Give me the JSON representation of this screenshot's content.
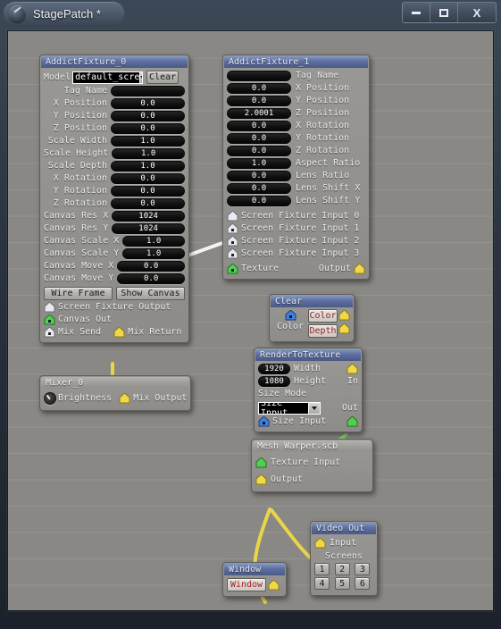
{
  "window": {
    "title": "StagePatch *",
    "app_icon": "disc-icon",
    "buttons": [
      {
        "name": "minimize",
        "glyph": "minimize-icon",
        "label": ""
      },
      {
        "name": "maximize",
        "glyph": "maximize-icon",
        "label": ""
      },
      {
        "name": "close",
        "glyph": "close-icon",
        "label": "X"
      }
    ]
  },
  "nodes": {
    "addict_fixture_0": {
      "title": "AddictFixture_0",
      "model_label": "Model",
      "model_value": "default_scre",
      "clear_button": "Clear",
      "fields": [
        {
          "label": "Tag Name",
          "value": ""
        },
        {
          "label": "X Position",
          "value": "0.0"
        },
        {
          "label": "Y Position",
          "value": "0.0"
        },
        {
          "label": "Z Position",
          "value": "0.0"
        },
        {
          "label": "Scale Width",
          "value": "1.0"
        },
        {
          "label": "Scale Height",
          "value": "1.0"
        },
        {
          "label": "Scale Depth",
          "value": "1.0"
        },
        {
          "label": "X Rotation",
          "value": "0.0"
        },
        {
          "label": "Y Rotation",
          "value": "0.0"
        },
        {
          "label": "Z Rotation",
          "value": "0.0"
        },
        {
          "label": "Canvas Res X",
          "value": "1024"
        },
        {
          "label": "Canvas Res Y",
          "value": "1024"
        },
        {
          "label": "Canvas Scale X",
          "value": "1.0"
        },
        {
          "label": "Canvas Scale Y",
          "value": "1.0"
        },
        {
          "label": "Canvas Move X",
          "value": "0.0"
        },
        {
          "label": "Canvas Move Y",
          "value": "0.0"
        }
      ],
      "wire_frame_button": "Wire Frame",
      "show_canvas_button": "Show Canvas",
      "ports": [
        {
          "label": "Screen Fixture Output",
          "color": "#e9e9ef",
          "kind": "output"
        },
        {
          "label": "Canvas Out",
          "color": "#4fd04f",
          "kind": "output"
        },
        {
          "label": "Mix Send",
          "color": "#e9e9ef",
          "kind": "output"
        },
        {
          "label": "Mix Return",
          "color": "#efd84a",
          "kind": "input"
        }
      ]
    },
    "addict_fixture_1": {
      "title": "AddictFixture_1",
      "fields": [
        {
          "label": "Tag Name",
          "value": ""
        },
        {
          "label": "X Position",
          "value": "0.0"
        },
        {
          "label": "Y Position",
          "value": "0.0"
        },
        {
          "label": "Z Position",
          "value": "2.0001"
        },
        {
          "label": "X Rotation",
          "value": "0.0"
        },
        {
          "label": "Y Rotation",
          "value": "0.0"
        },
        {
          "label": "Z Rotation",
          "value": "0.0"
        },
        {
          "label": "Aspect Ratio",
          "value": "1.0"
        },
        {
          "label": "Lens Ratio",
          "value": "0.0"
        },
        {
          "label": "Lens Shift X",
          "value": "0.0"
        },
        {
          "label": "Lens Shift Y",
          "value": "0.0"
        }
      ],
      "inputs": [
        {
          "label": "Screen Fixture Input 0",
          "color": "#e9e9ef"
        },
        {
          "label": "Screen Fixture Input 1",
          "color": "#e9e9ef"
        },
        {
          "label": "Screen Fixture Input 2",
          "color": "#e9e9ef"
        },
        {
          "label": "Screen Fixture Input 3",
          "color": "#e9e9ef"
        }
      ],
      "texture_label": "Texture",
      "texture_color": "#4fd04f",
      "output_label": "Output",
      "output_color": "#efd84a"
    },
    "mixer_0": {
      "title": "Mixer_0",
      "brightness_label": "Brightness",
      "mix_output_label": "Mix Output",
      "mix_output_color": "#efd84a"
    },
    "clear": {
      "title": "Clear",
      "color_port_label": "Color",
      "color_port_color": "#3f7fe0",
      "color_button": "Color",
      "depth_button": "Depth",
      "in_port_color": "#efd84a",
      "out_port_color": "#efd84a"
    },
    "render_to_texture": {
      "title": "RenderToTexture",
      "width_value": "1920",
      "width_label": "Width",
      "height_value": "1080",
      "height_label": "Height",
      "size_mode_label": "Size Mode",
      "size_mode_value": "Size Input",
      "size_input_label": "Size Input",
      "size_input_color": "#3f7fe0",
      "in_label": "In",
      "in_color": "#efd84a",
      "out_label": "Out",
      "out_color": "#4fd04f"
    },
    "mesh_warper": {
      "title": "Mesh Warper.scb",
      "texture_input_label": "Texture Input",
      "texture_input_color": "#4fd04f",
      "output_label": "Output",
      "output_color": "#efd84a"
    },
    "window_node": {
      "title": "Window",
      "button_label": "Window",
      "port_color": "#efd84a"
    },
    "video_out": {
      "title": "Video Out",
      "input_label": "Input",
      "input_color": "#efd84a",
      "screens_label": "Screens",
      "screens": [
        "1",
        "2",
        "3",
        "4",
        "5",
        "6"
      ]
    }
  },
  "wire_colors": {
    "white": "#f2f2f2",
    "yellow": "#e8d54a",
    "green": "#7fd46b"
  }
}
